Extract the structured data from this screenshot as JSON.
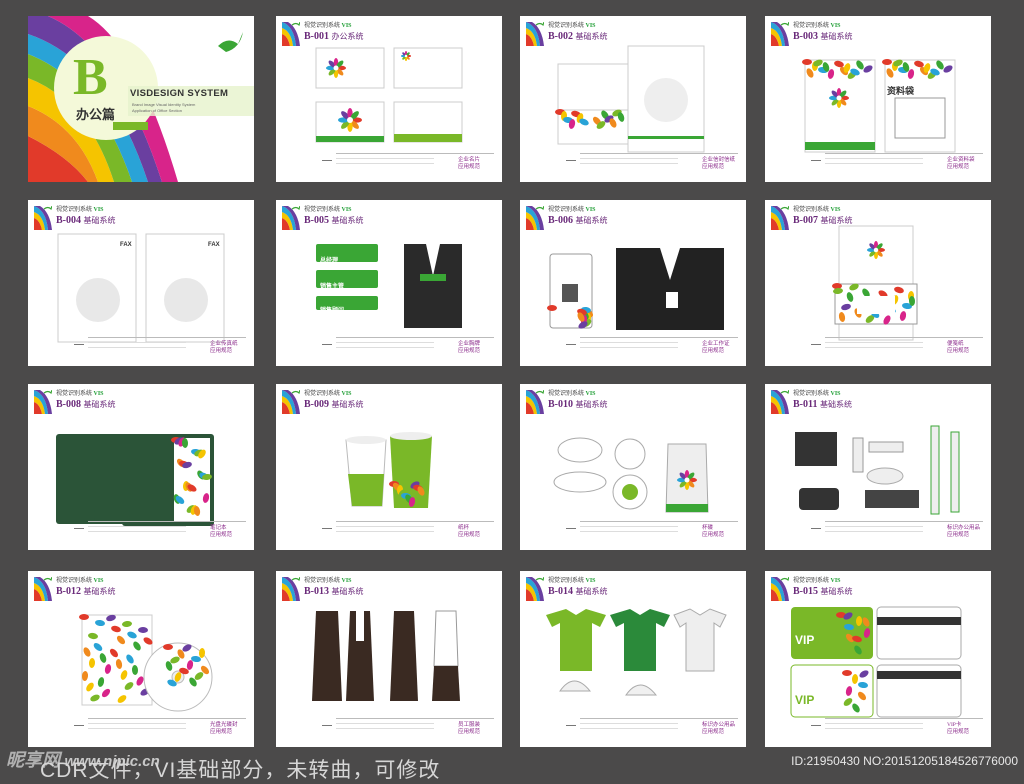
{
  "cover": {
    "letter": "B",
    "sub": "办公篇",
    "title": "VISDESIGN SYSTEM",
    "lines": [
      "Brand Image Visual Identity System",
      "Application of Office Section"
    ]
  },
  "header_small": "视觉识别系统",
  "header_vis": "VIS",
  "pages": [
    {
      "code": "B-001",
      "name": "办公系统",
      "foot": [
        "企业名片",
        "应用规范"
      ]
    },
    {
      "code": "B-002",
      "name": "基础系统",
      "foot": [
        "企业信封信纸",
        "应用规范"
      ]
    },
    {
      "code": "B-003",
      "name": "基础系统",
      "foot": [
        "企业资料袋",
        "应用规范"
      ]
    },
    {
      "code": "B-004",
      "name": "基础系统",
      "foot": [
        "企业传真纸",
        "应用规范"
      ]
    },
    {
      "code": "B-005",
      "name": "基础系统",
      "foot": [
        "企业胸牌",
        "应用规范"
      ]
    },
    {
      "code": "B-006",
      "name": "基础系统",
      "foot": [
        "企业工作证",
        "应用规范"
      ]
    },
    {
      "code": "B-007",
      "name": "基础系统",
      "foot": [
        "便笺纸",
        "应用规范"
      ]
    },
    {
      "code": "B-008",
      "name": "基础系统",
      "foot": [
        "笔记本",
        "应用规范"
      ]
    },
    {
      "code": "B-009",
      "name": "基础系统",
      "foot": [
        "纸杯",
        "应用规范"
      ]
    },
    {
      "code": "B-010",
      "name": "基础系统",
      "foot": [
        "杯碟",
        "应用规范"
      ]
    },
    {
      "code": "B-011",
      "name": "基础系统",
      "foot": [
        "标识办公用品",
        "应用规范"
      ]
    },
    {
      "code": "B-012",
      "name": "基础系统",
      "foot": [
        "光盘光碟封",
        "应用规范"
      ]
    },
    {
      "code": "B-013",
      "name": "基础系统",
      "foot": [
        "员工服装",
        "应用规范"
      ]
    },
    {
      "code": "B-014",
      "name": "基础系统",
      "foot": [
        "标识办公用品",
        "应用规范"
      ]
    },
    {
      "code": "B-015",
      "name": "基础系统",
      "foot": [
        "VIP卡",
        "应用规范"
      ]
    }
  ],
  "mock": {
    "org_name": "中国有机谷",
    "file_bag": "资料袋",
    "fax": "FAX",
    "badge1": "总经理",
    "badge2": "销售主管",
    "badge3": "销售顾问",
    "vip": "VIP"
  },
  "watermark": {
    "site": "昵享网",
    "url": "www.nipic.cn",
    "caption": "CDR文件，VI基础部分，未转曲，可修改",
    "id": "ID:21950430 NO:20151205184526776000"
  },
  "colors": {
    "bg": "#4b4a4a",
    "green": "#3aa635",
    "purple": "#6a2a7a"
  }
}
